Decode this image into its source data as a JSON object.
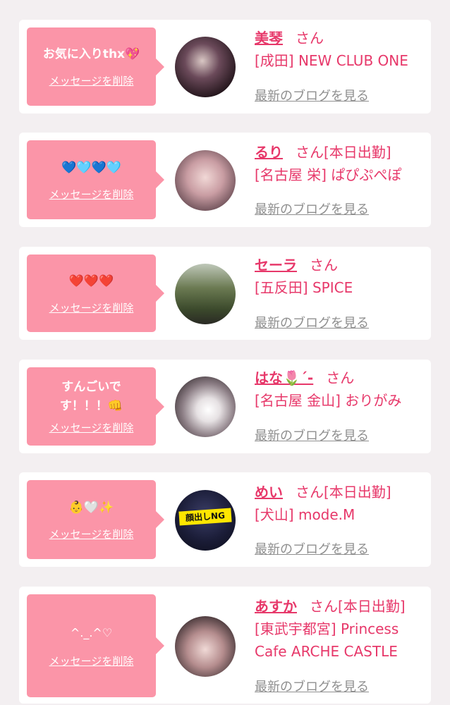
{
  "delete_label": "メッセージを削除",
  "san_label": "さん",
  "blog_label": "最新のブログを見る",
  "colors": {
    "bubble": "#fb95a8",
    "name": "#e7386a",
    "background": "#f3eff1"
  },
  "cards": [
    {
      "message": "お気に入りthx💖",
      "name": "美琴",
      "tag": "",
      "shop": "[成田] NEW CLUB ONE"
    },
    {
      "message": "💙🩵💙🩵",
      "name": "るり",
      "tag": "[本日出勤]",
      "shop": "[名古屋 栄] ぱぴぷぺぽ"
    },
    {
      "message": "❤️❤️❤️",
      "name": "セーラ",
      "tag": "",
      "shop": "[五反田] SPICE"
    },
    {
      "message": "すんごいです！！！👊",
      "name": "はな🌷´-",
      "tag": "",
      "shop": "[名古屋 金山] おりがみ"
    },
    {
      "message": "👶🤍✨",
      "name": "めい",
      "tag": "[本日出勤]",
      "shop": "[犬山] mode.M",
      "avatar_label": "顔出しNG"
    },
    {
      "message": "^._.^♡",
      "name": "あすか",
      "tag": "[本日出勤]",
      "shop": "[東武宇都宮] Princess Cafe ARCHE CASTLE"
    }
  ]
}
